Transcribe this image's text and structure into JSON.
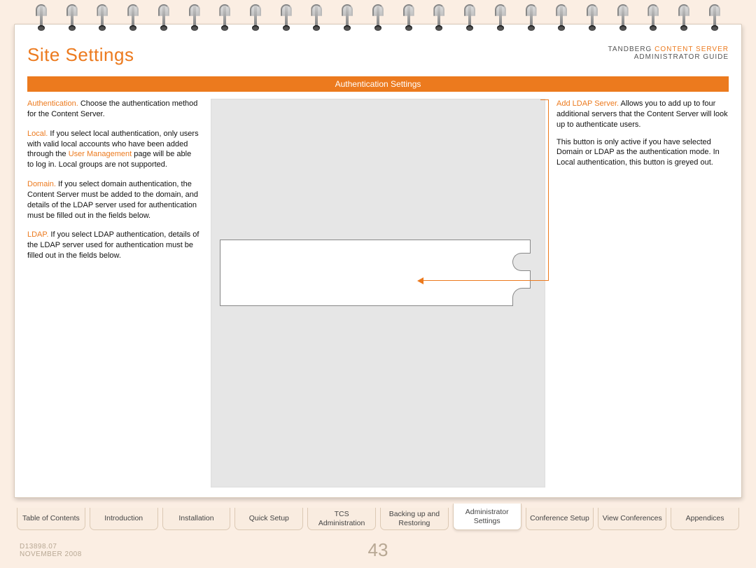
{
  "page_title": "Site Settings",
  "brand": {
    "line1_a": "TANDBERG ",
    "line1_b": "CONTENT SERVER",
    "line2": "ADMINISTRATOR GUIDE"
  },
  "section_bar": "Authentication Settings",
  "left": {
    "p1_term": "Authentication.",
    "p1_text": " Choose the authentication method for the Content Server.",
    "p2_term": "Local.",
    "p2_text_a": " If you select local authentication, only users with valid local accounts who have been added through the ",
    "p2_link": "User Management",
    "p2_text_b": " page will be able to log in. Local groups are not supported.",
    "p3_term": "Domain.",
    "p3_text": " If you select domain authentication, the Content Server must be added to the domain, and details of the LDAP server used for authentication must be filled out in the fields below.",
    "p4_term": "LDAP.",
    "p4_text": " If you select LDAP authentication, details of the LDAP server used for authentication must be filled out in the fields below."
  },
  "right": {
    "p1_term": "Add LDAP Server.",
    "p1_text": " Allows you to add up to four additional servers that the Content Server will look up to authenticate users.",
    "p2_text": "This button is only active if you have selected Domain or LDAP as the authentication mode. In Local authentication, this button is greyed out."
  },
  "tabs": [
    {
      "label": "Table of Contents",
      "active": false
    },
    {
      "label": "Introduction",
      "active": false
    },
    {
      "label": "Installation",
      "active": false
    },
    {
      "label": "Quick Setup",
      "active": false
    },
    {
      "label": "TCS Administration",
      "active": false
    },
    {
      "label": "Backing up and Restoring",
      "active": false
    },
    {
      "label": "Administrator Settings",
      "active": true
    },
    {
      "label": "Conference Setup",
      "active": false
    },
    {
      "label": "View Conferences",
      "active": false
    },
    {
      "label": "Appendices",
      "active": false
    }
  ],
  "footer": {
    "doc_id": "D13898.07",
    "date": "NOVEMBER 2008"
  },
  "page_number": "43"
}
